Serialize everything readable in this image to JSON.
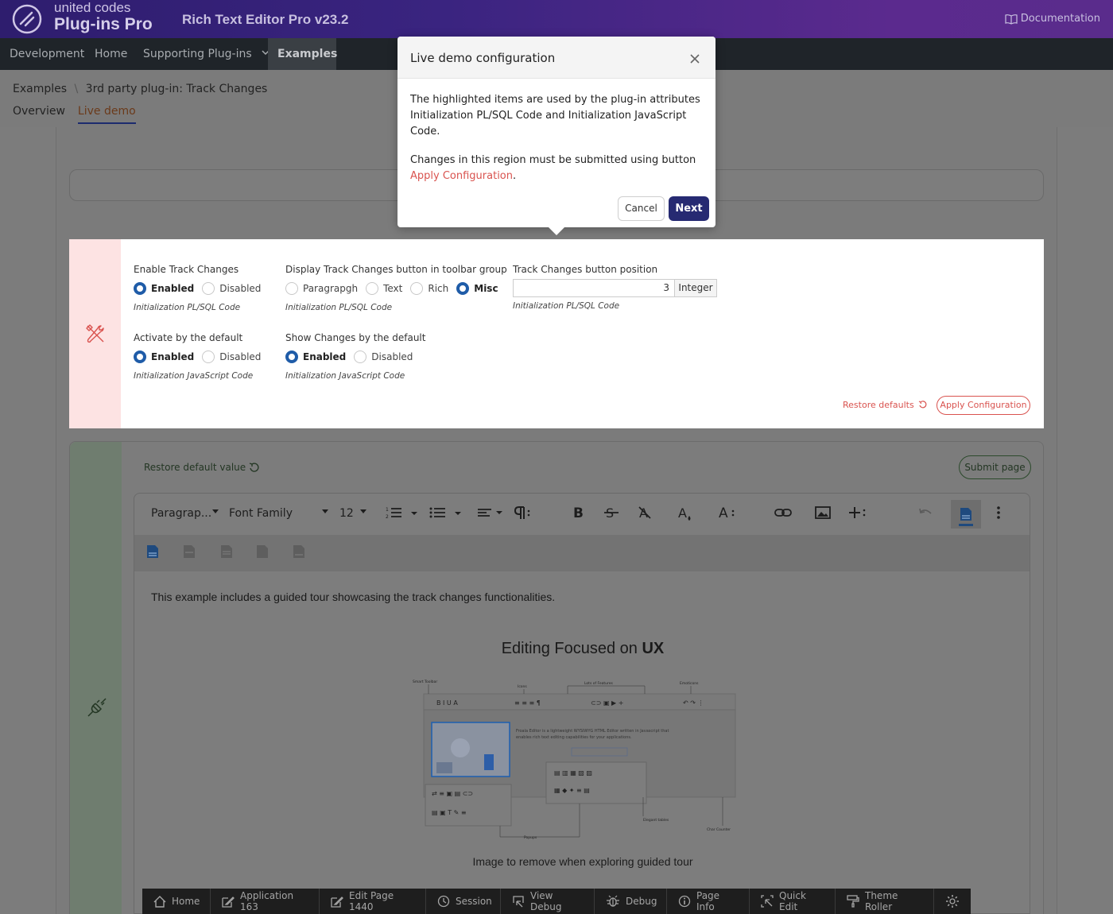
{
  "header": {
    "brand_line1": "united codes",
    "brand_line2": "Plug-ins Pro",
    "app_title": "Rich Text Editor Pro v23.2",
    "documentation_label": "Documentation"
  },
  "nav": {
    "items": [
      {
        "label": "Development",
        "active": false
      },
      {
        "label": "Home",
        "active": false
      },
      {
        "label": "Supporting Plug-ins",
        "active": false
      },
      {
        "label": "Examples",
        "active": true
      }
    ]
  },
  "breadcrumb": {
    "root": "Examples",
    "separator": "\\",
    "current": "3rd party plug-in: Track Changes"
  },
  "tabs": [
    {
      "label": "Overview",
      "active": false
    },
    {
      "label": "Live demo",
      "active": true
    }
  ],
  "config": {
    "enable_track_changes": {
      "label": "Enable Track Changes",
      "options": [
        "Enabled",
        "Disabled"
      ],
      "selected": "Enabled",
      "hint": "Initialization PL/SQL Code"
    },
    "display_button_group": {
      "label": "Display Track Changes button in toolbar group",
      "options": [
        "Paragrapgh",
        "Text",
        "Rich",
        "Misc"
      ],
      "selected": "Misc",
      "hint": "Initialization PL/SQL Code"
    },
    "button_position": {
      "label": "Track Changes button position",
      "value": "3",
      "unit": "Integer",
      "hint": "Initialization PL/SQL Code"
    },
    "activate_by_default": {
      "label": "Activate by the default",
      "options": [
        "Enabled",
        "Disabled"
      ],
      "selected": "Enabled",
      "hint": "Initialization JavaScript Code"
    },
    "show_changes_by_default": {
      "label": "Show Changes by the default",
      "options": [
        "Enabled",
        "Disabled"
      ],
      "selected": "Enabled",
      "hint": "Initialization JavaScript Code"
    },
    "restore_defaults_label": "Restore defaults",
    "apply_label": "Apply Configuration"
  },
  "editor_region": {
    "restore_default_value_label": "Restore default value",
    "submit_label": "Submit page",
    "toolbar": {
      "paragraph": "Paragrap...",
      "font_family": "Font Family",
      "font_size": "12"
    },
    "content_text": "This example includes a guided tour showcasing the track changes functionalities.",
    "image_title_normal": "Editing Focused on ",
    "image_title_bold": "UX",
    "image_caption": "Image to remove when exploring guided tour"
  },
  "dev_toolbar": [
    {
      "label": "Home",
      "icon": "home-icon"
    },
    {
      "label": "Application 163",
      "icon": "edit-icon"
    },
    {
      "label": "Edit Page 1440",
      "icon": "edit-icon"
    },
    {
      "label": "Session",
      "icon": "clock-icon"
    },
    {
      "label": "View Debug",
      "icon": "view-debug-icon"
    },
    {
      "label": "Debug",
      "icon": "bug-icon"
    },
    {
      "label": "Page Info",
      "icon": "info-icon"
    },
    {
      "label": "Quick Edit",
      "icon": "quick-edit-icon"
    },
    {
      "label": "Theme Roller",
      "icon": "paint-roller-icon"
    },
    {
      "label": "",
      "icon": "gear-icon"
    }
  ],
  "dialog": {
    "title": "Live demo configuration",
    "paragraph1": "The highlighted items are used by the plug-in attributes Initialization PL/SQL Code and Initialization JavaScript Code.",
    "paragraph2_prefix": "Changes in this region must be submitted using button",
    "paragraph2_link": "Apply Configuration",
    "paragraph2_suffix": ".",
    "cancel_label": "Cancel",
    "next_label": "Next"
  },
  "colors": {
    "header_gradient_start": "#2e1d6e",
    "header_gradient_end": "#5a2c8c",
    "accent_red": "#d9534f",
    "radio_blue": "#1f5ca8",
    "next_button": "#262a72"
  }
}
